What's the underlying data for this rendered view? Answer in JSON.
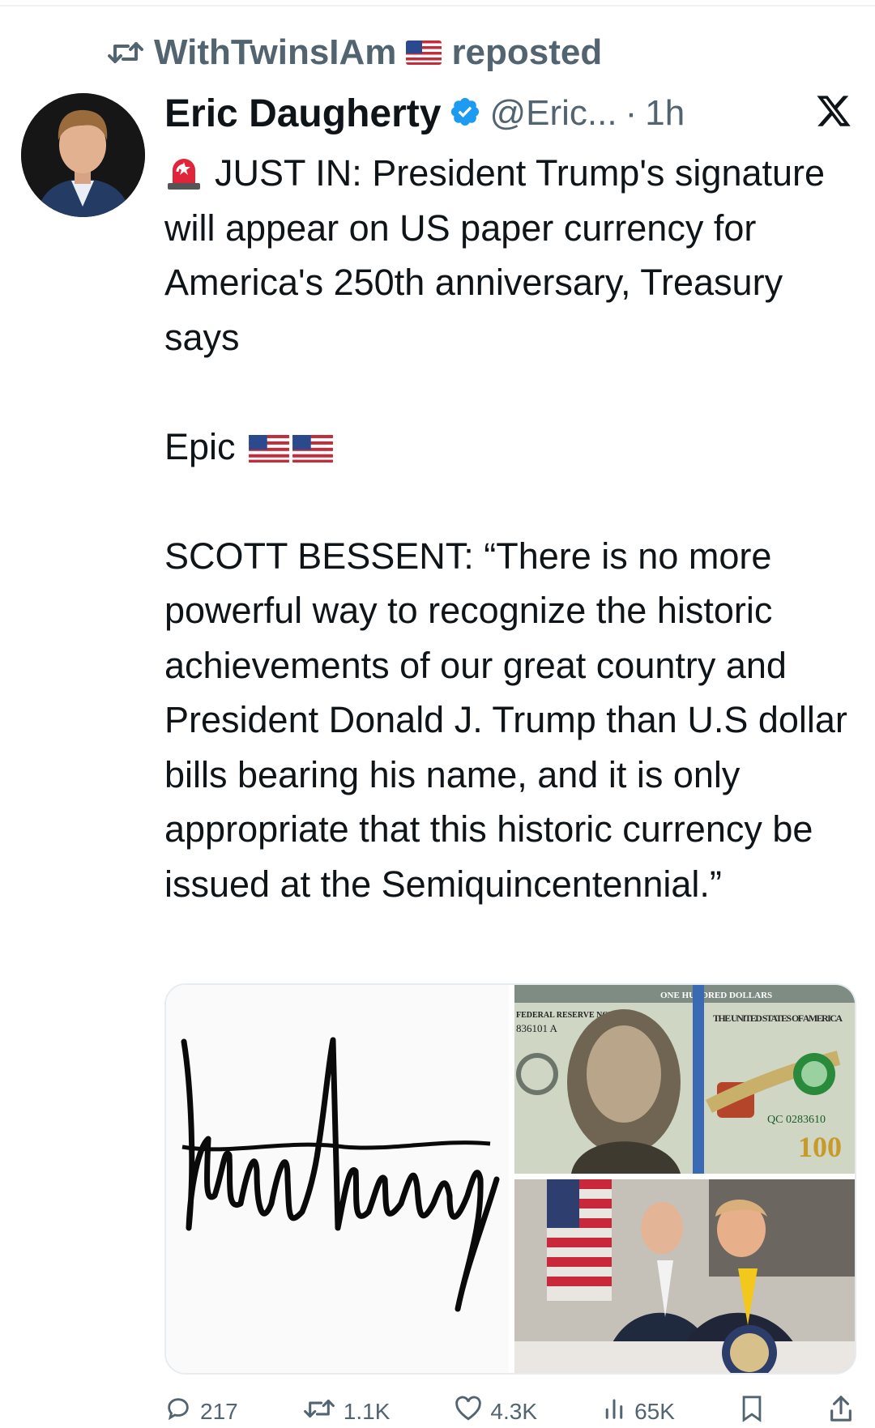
{
  "repost": {
    "user": "WithTwinsIAm",
    "label": "reposted",
    "icon": "repost-icon"
  },
  "author": {
    "name": "Eric Daugherty",
    "handle": "@Eric...",
    "separator": "·",
    "time": "1h",
    "verified": true
  },
  "brand": {
    "icon": "x-logo-icon"
  },
  "tweet": {
    "line1": "JUST IN: President Trump's signature will appear on US paper currency for America's 250th anniversary, Treasury says",
    "line2": "Epic",
    "line3": "SCOTT BESSENT: “There is no more powerful way to recognize the historic achievements of our great country and President Donald J. Trump than U.S dollar bills bearing his name, and it is only appropriate that this historic currency be issued at the Semiquincentennial.”"
  },
  "media": {
    "items": [
      "signature-image",
      "hundred-dollar-bill-image",
      "meeting-photo-image"
    ],
    "bill": {
      "denomination": "ONE HUNDRED DOLLARS",
      "note": "FEDERAL RESERVE NOTE",
      "serial_left": "836101 A",
      "serial_right": "QC 0283610",
      "country": "THE UNITED STATES OF AMERICA",
      "value": "100"
    }
  },
  "actions": {
    "replies": "217",
    "reposts": "1.1K",
    "likes": "4.3K",
    "views": "65K"
  },
  "colors": {
    "text": "#0f1419",
    "secondary": "#536471",
    "verified": "#1d9bf0",
    "border": "#e6ecf0"
  }
}
